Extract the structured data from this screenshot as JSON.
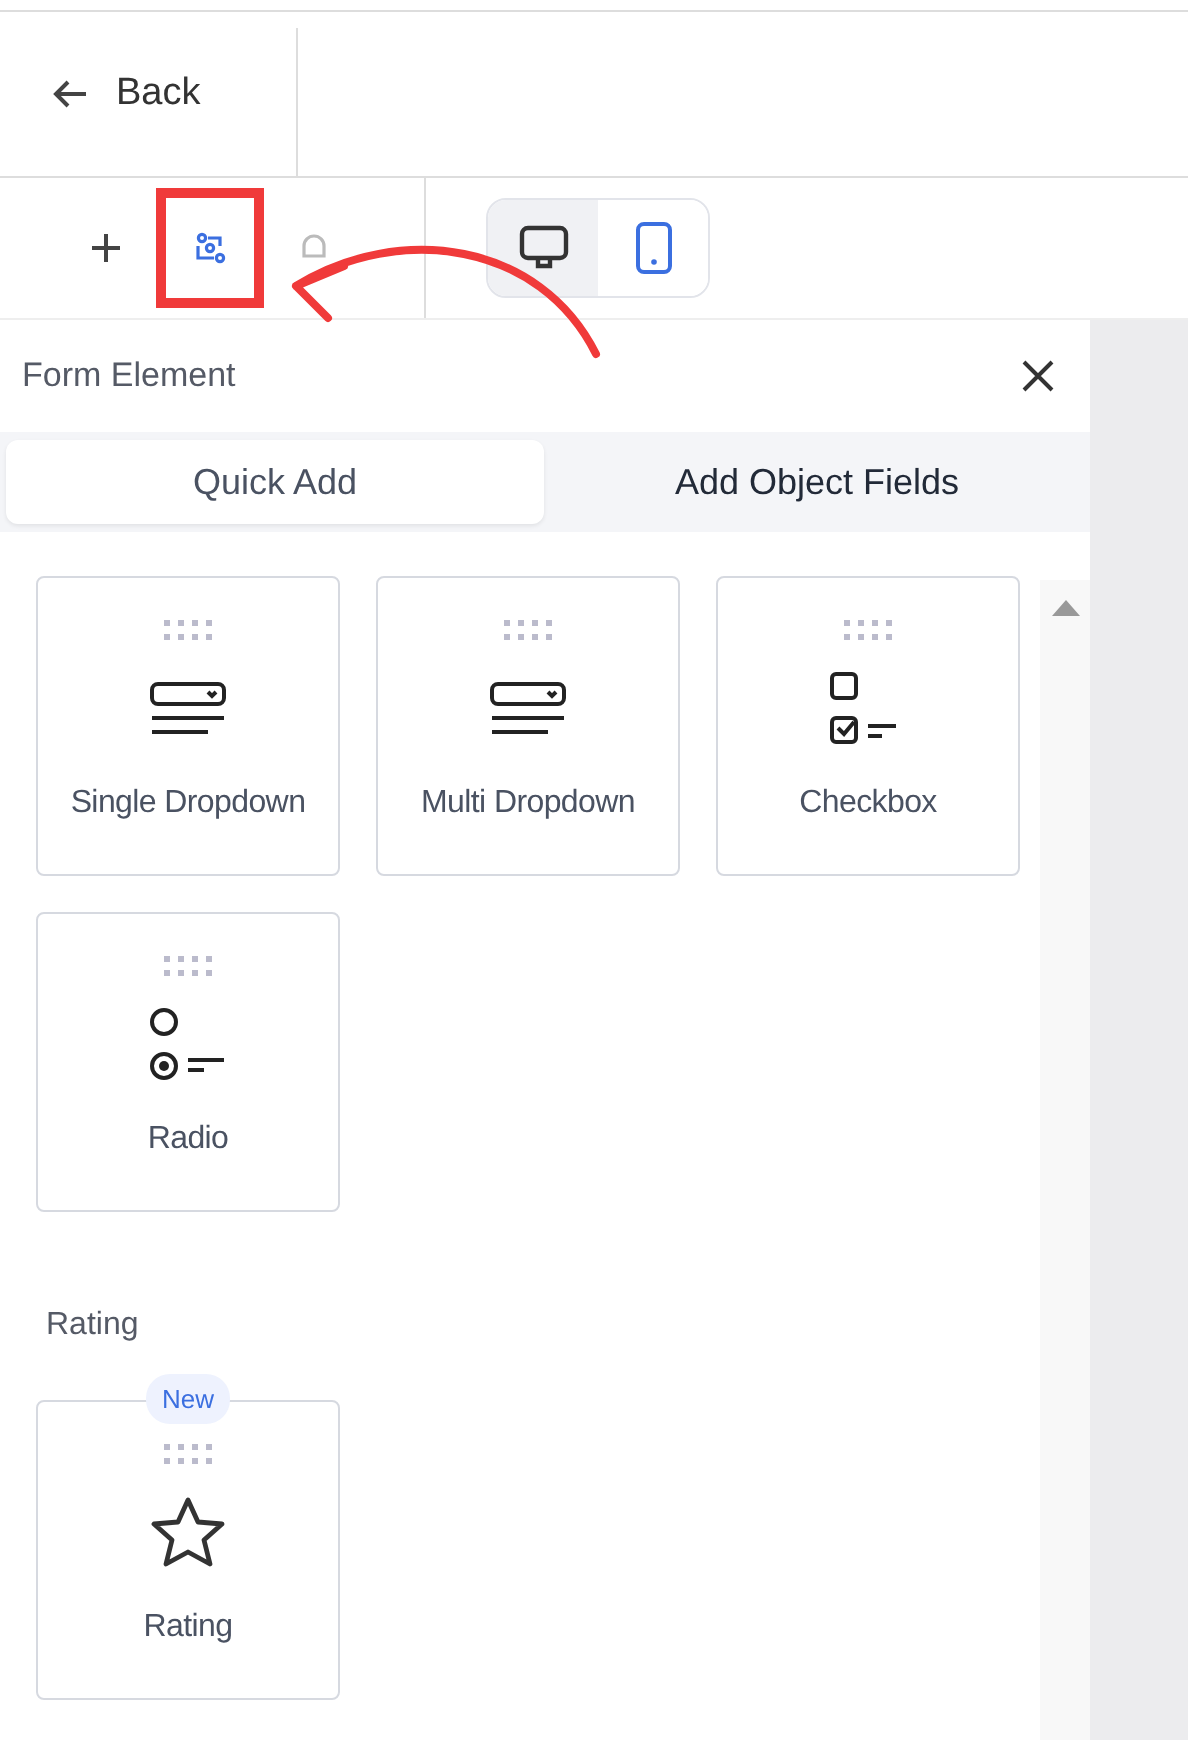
{
  "header": {
    "back": "Back"
  },
  "toolbar": {
    "tools": [
      {
        "kind": "add",
        "highlighted": false
      },
      {
        "kind": "form",
        "highlighted": true
      },
      {
        "kind": "bell",
        "highlighted": false
      }
    ],
    "devices": [
      {
        "kind": "desktop",
        "selected": false
      },
      {
        "kind": "mobile",
        "selected": true
      }
    ]
  },
  "panel": {
    "title": "Form Element",
    "tabs": [
      {
        "label": "Quick Add",
        "selected": true
      },
      {
        "label": "Add Object Fields",
        "selected": false
      }
    ],
    "groups": [
      {
        "items": [
          {
            "kind": "dropdown",
            "label": "Single Dropdown"
          },
          {
            "kind": "dropdown",
            "label": "Multi Dropdown"
          },
          {
            "kind": "checkbox",
            "label": "Checkbox"
          },
          {
            "kind": "radio",
            "label": "Radio"
          }
        ]
      },
      {
        "heading": "Rating",
        "items": [
          {
            "kind": "rating",
            "label": "Rating",
            "badge": "New"
          }
        ]
      }
    ]
  }
}
